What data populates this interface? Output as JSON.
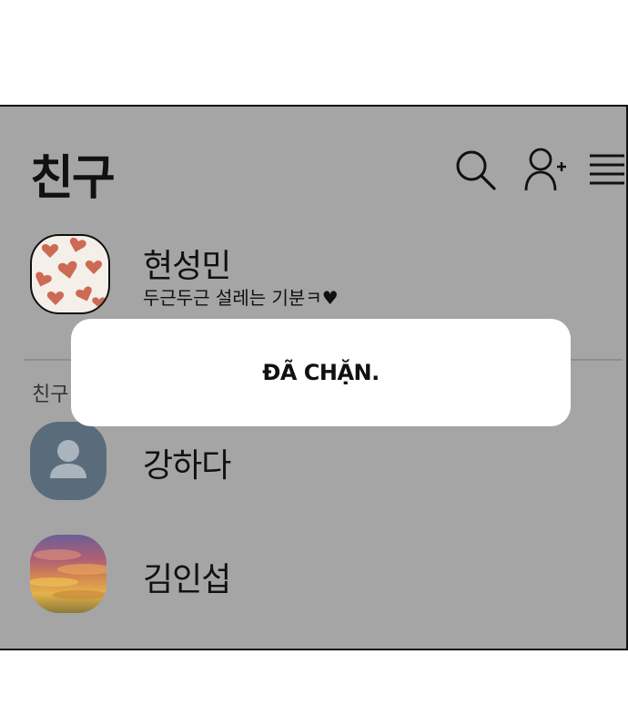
{
  "header": {
    "title": "친구"
  },
  "icons": {
    "search": "search-icon",
    "add_friend": "add-friend-icon",
    "menu": "menu-icon"
  },
  "profile": {
    "name": "현성민",
    "status": "두근두근 설레는 기분ㅋ♥"
  },
  "section": {
    "label": "친구"
  },
  "friends": [
    {
      "name": "강하다",
      "avatar": "default-person-icon"
    },
    {
      "name": "김인섭",
      "avatar": "sunset-photo"
    }
  ],
  "toast": {
    "text": "ĐÃ CHẶN."
  },
  "colors": {
    "overlay": "#a5a5a5",
    "default_avatar": "#5a6c7c",
    "toast_bg": "#ffffff",
    "heart": "#cd6a55"
  }
}
